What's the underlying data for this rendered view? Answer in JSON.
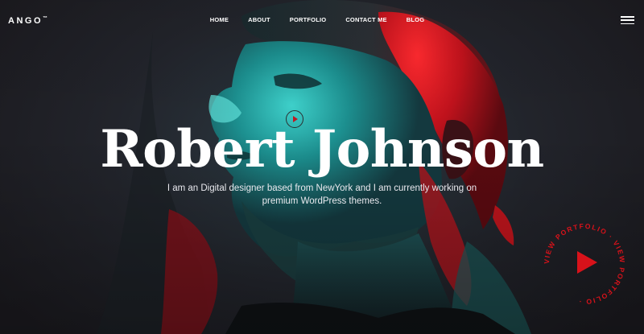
{
  "header": {
    "logo": "ANGO",
    "logo_mark": "™",
    "nav": [
      {
        "label": "HOME"
      },
      {
        "label": "ABOUT"
      },
      {
        "label": "PORTFOLIO"
      },
      {
        "label": "CONTACT ME"
      },
      {
        "label": "BLOG"
      }
    ],
    "menu_icon": "hamburger-icon"
  },
  "hero": {
    "title": "Robert Johnson",
    "subtitle": "I am an Digital designer based from NewYork and I am currently working on premium WordPress themes.",
    "small_play_icon": "play-icon",
    "badge": {
      "circular_text": "VIEW PORTFOLIO · VIEW PORTFOLIO ·",
      "icon": "play-triangle-icon"
    }
  },
  "colors": {
    "accent_red": "#d8121a",
    "teal": "#1fb6b3",
    "text": "#ffffff"
  }
}
